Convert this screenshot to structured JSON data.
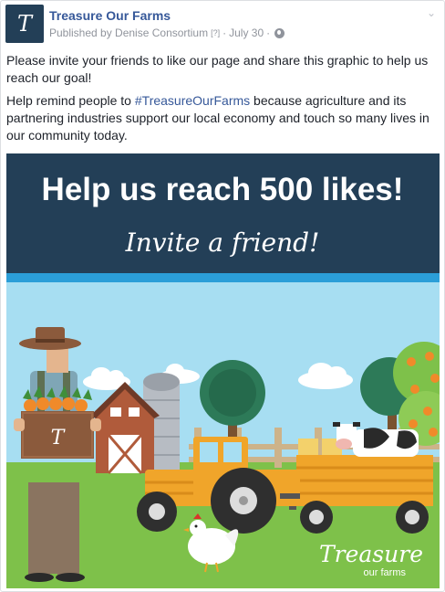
{
  "post": {
    "page_name": "Treasure Our Farms",
    "avatar_letter": "T",
    "published_by": "Published by Denise Consortium",
    "help_mark": "[?]",
    "separator": "·",
    "date": "July 30",
    "separator2": "·",
    "icons": [
      "globe-icon",
      "chevron-down-icon"
    ],
    "text1": "Please invite your friends to like our page and share this graphic to help us reach our goal!",
    "text2_before": "Help remind people to ",
    "hashtag": "#TreasureOurFarms",
    "text2_after": " because agriculture and its partnering industries support our local economy and touch so many lives in our community today."
  },
  "graphic": {
    "headline": "Help us reach 500 likes!",
    "subline": "Invite a friend!",
    "box_letter": "T",
    "logo_main": "Treasure",
    "logo_sub": "our farms",
    "colors": {
      "banner": "#233f57",
      "stripe": "#2b9ed8",
      "sky": "#a7def2",
      "grass": "#7ec14a",
      "tractor": "#f0a52a"
    }
  }
}
